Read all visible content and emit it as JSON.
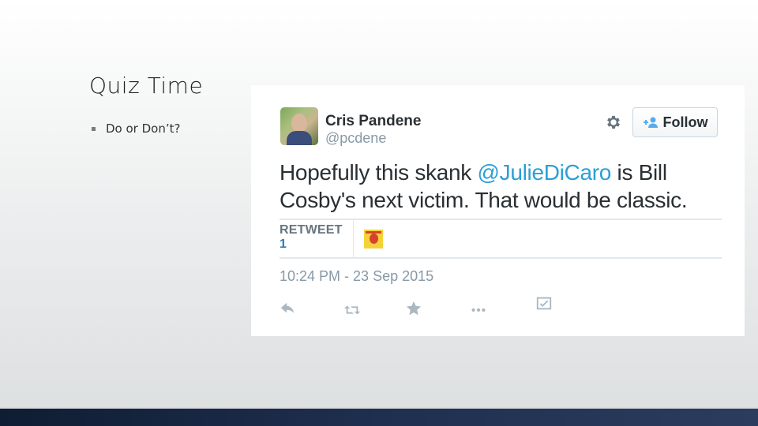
{
  "slide": {
    "title": "Quiz Time",
    "bullet": "Do or Don’t?"
  },
  "tweet": {
    "author": {
      "display_name": "Cris Pandene",
      "handle": "@pcdene"
    },
    "follow_label": "Follow",
    "text_before": "Hopefully this skank ",
    "mention": "@JulieDiCaro",
    "text_after": " is Bill Cosby's next victim. That would be classic.",
    "retweet_label": "RETWEET",
    "retweet_count": "1",
    "timestamp": "10:24 PM - 23 Sep 2015",
    "icons": {
      "settings": "gear-icon",
      "follow": "add-user-icon",
      "reply": "reply-icon",
      "retweet": "retweet-icon",
      "favorite": "star-icon",
      "more": "more-icon",
      "analytics": "analytics-icon"
    }
  },
  "colors": {
    "link": "#2b9fd6",
    "text": "#292f33",
    "muted": "#8899a6",
    "count": "#2b7bb9",
    "bottom_bar": "#1f2f4f"
  }
}
